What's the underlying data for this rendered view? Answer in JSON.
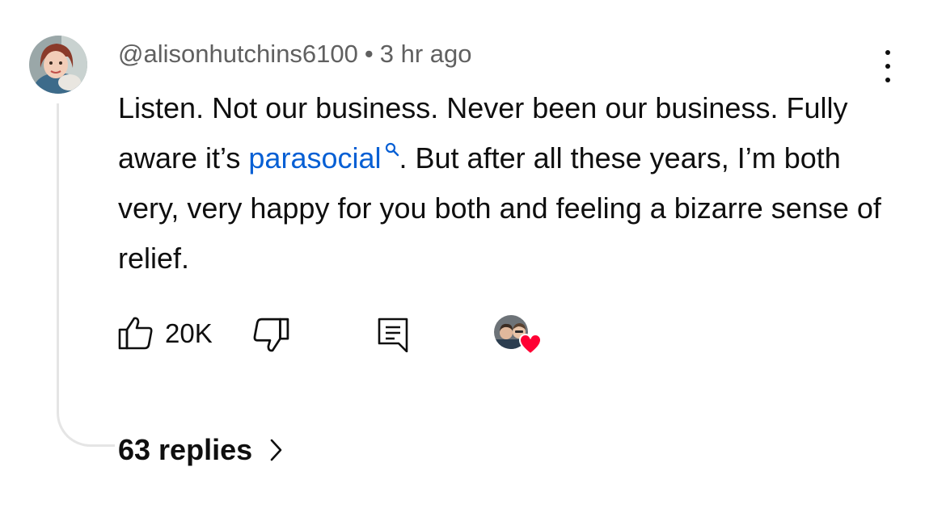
{
  "comment": {
    "author": "@alisonhutchins6100",
    "separator": "•",
    "time_ago": "3 hr ago",
    "text_part1": "Listen. Not our business. Never been our business. Fully aware it’s ",
    "link_text": "parasocial",
    "text_part2": ". But after all these years, I’m both very, very happy for you both and feeling a bizarre sense of relief."
  },
  "actions": {
    "like_count": "20K"
  },
  "replies": {
    "label": "63 replies"
  },
  "colors": {
    "link": "#065fd4",
    "meta_text": "#606060",
    "heart": "#ff0033",
    "thread_line": "#e5e5e5"
  },
  "icons": [
    "avatar",
    "more-vert-icon",
    "search-icon",
    "thumbs-up-icon",
    "thumbs-down-icon",
    "reply-icon",
    "creator-heart-icon",
    "chevron-right-icon"
  ]
}
